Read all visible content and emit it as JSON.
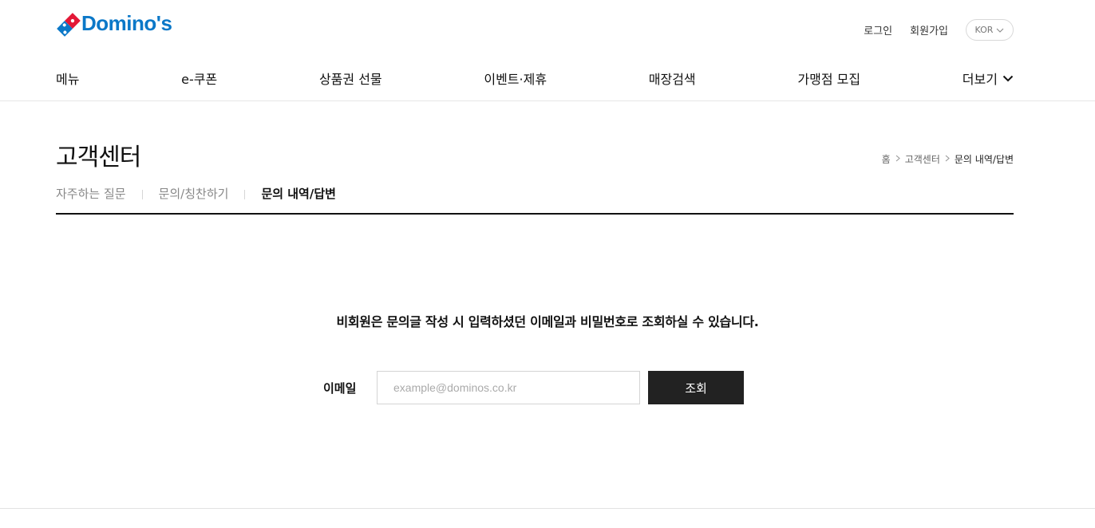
{
  "brand": {
    "logo_text": "Domino's",
    "color_primary": "#0b78c8",
    "color_red": "#e31837"
  },
  "util": {
    "login": "로그인",
    "signup": "회원가입",
    "lang": "KOR"
  },
  "gnb": [
    {
      "label": "메뉴"
    },
    {
      "label": "e-쿠폰"
    },
    {
      "label": "상품권 선물"
    },
    {
      "label": "이벤트·제휴"
    },
    {
      "label": "매장검색"
    },
    {
      "label": "가맹점 모집"
    },
    {
      "label": "더보기"
    }
  ],
  "page": {
    "title": "고객센터"
  },
  "breadcrumb": {
    "home": "홈",
    "parent": "고객센터",
    "current": "문의 내역/답변"
  },
  "tabs": [
    {
      "label": "자주하는 질문"
    },
    {
      "label": "문의/칭찬하기"
    },
    {
      "label": "문의 내역/답변"
    }
  ],
  "lookup": {
    "notice": "비회원은 문의글 작성 시 입력하셨던 이메일과 비밀번호로 조회하실 수 있습니다.",
    "email_label": "이메일",
    "email_placeholder": "example@dominos.co.kr",
    "email_value": "",
    "submit_label": "조회"
  }
}
